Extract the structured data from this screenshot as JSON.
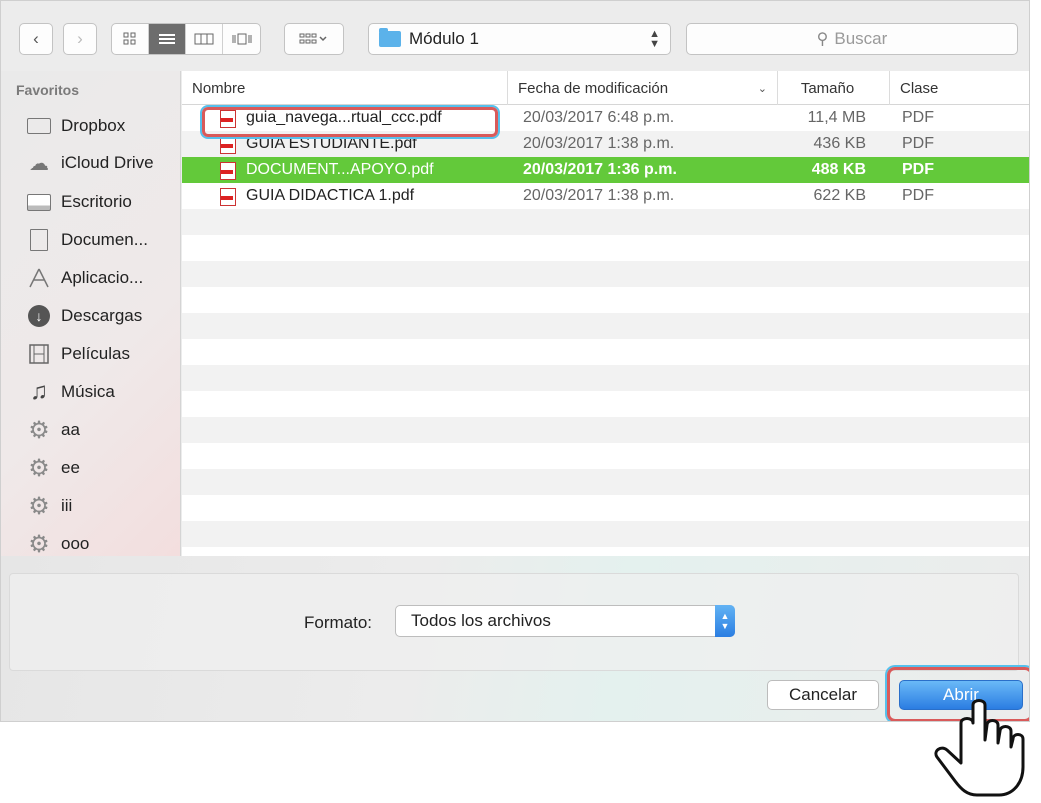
{
  "toolbar": {
    "back_icon": "chevron-left-icon",
    "forward_icon": "chevron-right-icon",
    "location": "Módulo 1",
    "search_placeholder": "Buscar"
  },
  "sidebar": {
    "heading": "Favoritos",
    "items": [
      {
        "label": "Dropbox",
        "icon": "folder-icon"
      },
      {
        "label": "iCloud Drive",
        "icon": "cloud-icon"
      },
      {
        "label": "Escritorio",
        "icon": "desktop-icon"
      },
      {
        "label": "Documen...",
        "icon": "document-icon"
      },
      {
        "label": "Aplicacio...",
        "icon": "applications-icon"
      },
      {
        "label": "Descargas",
        "icon": "download-icon"
      },
      {
        "label": "Películas",
        "icon": "film-icon"
      },
      {
        "label": "Música",
        "icon": "music-icon"
      },
      {
        "label": "aa",
        "icon": "gear-icon"
      },
      {
        "label": "ee",
        "icon": "gear-icon"
      },
      {
        "label": "iii",
        "icon": "gear-icon"
      },
      {
        "label": "ooo",
        "icon": "gear-icon"
      }
    ]
  },
  "columns": {
    "name": "Nombre",
    "date": "Fecha de modificación",
    "size": "Tamaño",
    "kind": "Clase"
  },
  "files": [
    {
      "name": "guia_navega...rtual_ccc.pdf",
      "date": "20/03/2017 6:48 p.m.",
      "size": "11,4 MB",
      "kind": "PDF",
      "selected": false
    },
    {
      "name": "GUÍA ESTUDIANTE.pdf",
      "date": "20/03/2017 1:38 p.m.",
      "size": "436 KB",
      "kind": "PDF",
      "selected": false
    },
    {
      "name": "DOCUMENT...APOYO.pdf",
      "date": "20/03/2017 1:36 p.m.",
      "size": "488 KB",
      "kind": "PDF",
      "selected": true
    },
    {
      "name": "GUIA DIDACTICA 1.pdf",
      "date": "20/03/2017 1:38 p.m.",
      "size": "622 KB",
      "kind": "PDF",
      "selected": false
    }
  ],
  "format": {
    "label": "Formato:",
    "value": "Todos los archivos"
  },
  "buttons": {
    "cancel": "Cancelar",
    "open": "Abrir"
  },
  "colors": {
    "selection": "#63c93a",
    "accent": "#2b7de2",
    "highlight": "#d95a5a"
  }
}
